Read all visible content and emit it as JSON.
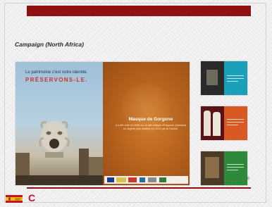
{
  "slide": {
    "title": "Campaign (North Africa)",
    "page_number": "8",
    "accent_color": "#8e1010"
  },
  "poster": {
    "tagline": "Le patrimoine c'est notre identité.",
    "headline": "PRÉSERVONS-LE.",
    "caption_title": "Masque de Gorgone",
    "caption_text": "Il a été volé en 1996 sur le site antique d'Hippone (Annaba) en Algérie puis restitué en 2014 par la Tunisie."
  },
  "thumbnails": [
    {
      "left_color": "#2a2a2a",
      "right_color": "#1aa0b8"
    },
    {
      "left_color": "#7a1616",
      "right_color": "#d85a22"
    },
    {
      "left_color": "#4a3a28",
      "right_color": "#2e8a3a"
    }
  ],
  "footer": {
    "logo_flag": "spain-flag-logo",
    "logo_c": "C"
  }
}
